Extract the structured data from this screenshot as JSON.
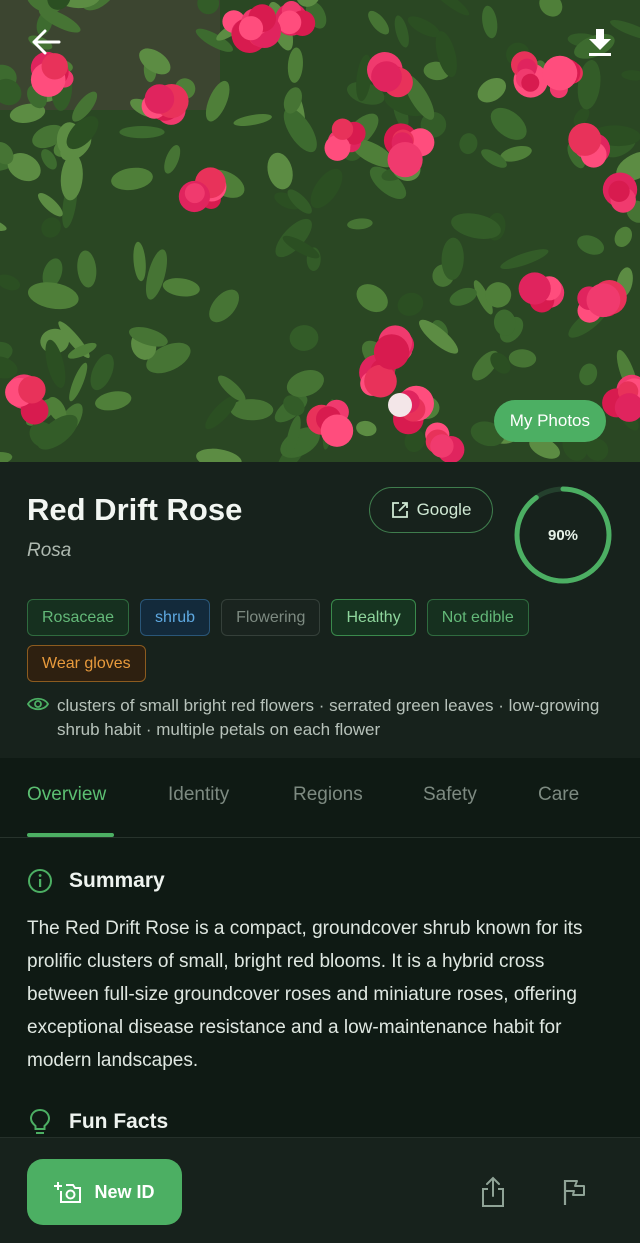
{
  "hero": {
    "my_photos_label": "My Photos"
  },
  "plant": {
    "common_name": "Red Drift Rose",
    "genus": "Rosa",
    "confidence": 0.9,
    "confidence_label": "90%",
    "google_label": "Google"
  },
  "tags": [
    {
      "label": "Rosaceae",
      "style": "green"
    },
    {
      "label": "shrub",
      "style": "blue"
    },
    {
      "label": "Flowering",
      "style": "muted"
    },
    {
      "label": "Healthy",
      "style": "bright"
    },
    {
      "label": "Not edible",
      "style": "green"
    },
    {
      "label": "Wear gloves",
      "style": "orange"
    }
  ],
  "visual_features": "clusters of small bright red flowers · serrated green leaves · low-growing shrub habit · multiple petals on each flower",
  "tabs": [
    {
      "label": "Overview",
      "active": true
    },
    {
      "label": "Identity",
      "active": false
    },
    {
      "label": "Regions",
      "active": false
    },
    {
      "label": "Safety",
      "active": false
    },
    {
      "label": "Care",
      "active": false
    }
  ],
  "summary": {
    "heading": "Summary",
    "text": "The Red Drift Rose is a compact, groundcover shrub known for its prolific clusters of small, bright red blooms. It is a hybrid cross between full-size groundcover roses and miniature roses, offering exceptional disease resistance and a low-maintenance habit for modern landscapes."
  },
  "fun_facts": {
    "heading": "Fun Facts"
  },
  "bottom_bar": {
    "new_id_label": "New ID"
  },
  "colors": {
    "accent": "#4caf63",
    "background": "#0f1a14",
    "card": "#17221c"
  },
  "icons": {
    "back": "arrow-left-icon",
    "download": "download-icon",
    "google": "external-link-icon",
    "features": "eye-icon",
    "summary": "info-icon",
    "fun_facts": "lightbulb-icon",
    "new_id": "camera-plus-icon",
    "share": "share-icon",
    "report": "flag-icon"
  }
}
